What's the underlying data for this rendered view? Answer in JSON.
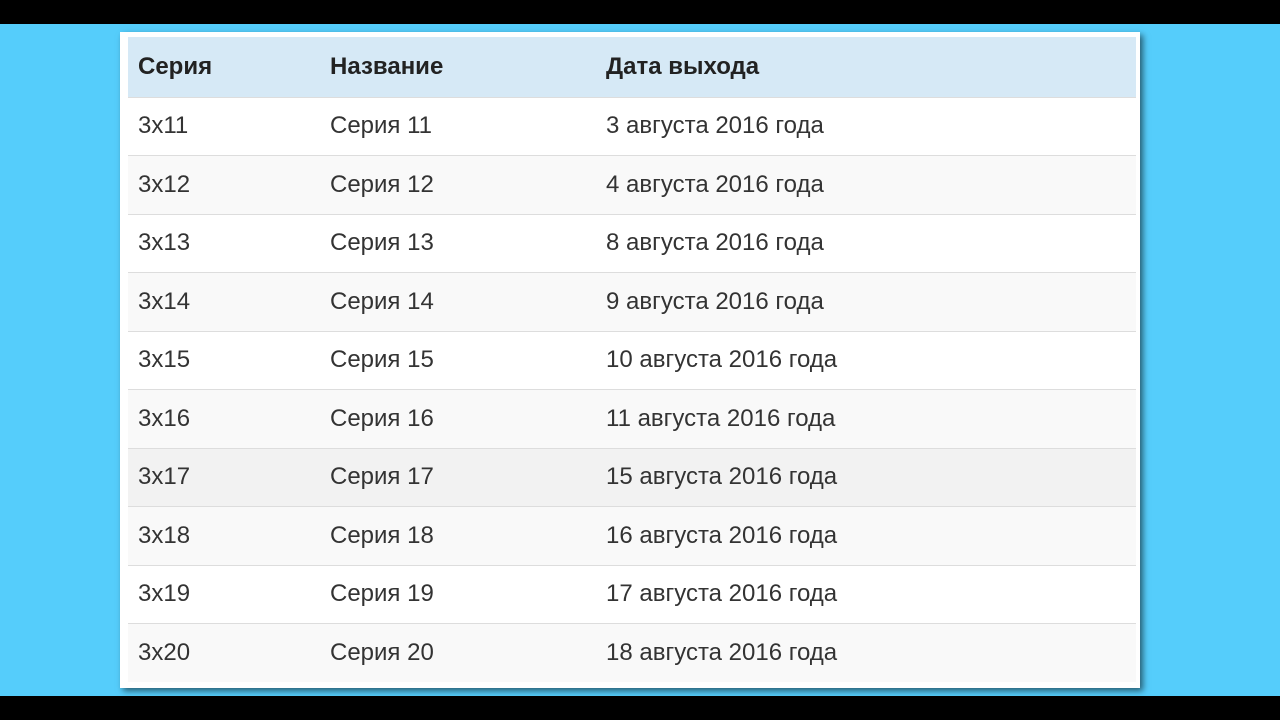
{
  "table": {
    "headers": [
      "Серия",
      "Название",
      "Дата выхода"
    ],
    "rows": [
      [
        "3x11",
        "Серия 11",
        "3 августа 2016 года"
      ],
      [
        "3x12",
        "Серия 12",
        "4 августа 2016 года"
      ],
      [
        "3x13",
        "Серия 13",
        "8 августа 2016 года"
      ],
      [
        "3x14",
        "Серия 14",
        "9 августа 2016 года"
      ],
      [
        "3x15",
        "Серия 15",
        "10 августа 2016 года"
      ],
      [
        "3x16",
        "Серия 16",
        "11 августа 2016 года"
      ],
      [
        "3x17",
        "Серия 17",
        "15 августа 2016 года"
      ],
      [
        "3x18",
        "Серия 18",
        "16 августа 2016 года"
      ],
      [
        "3x19",
        "Серия 19",
        "17 августа 2016 года"
      ],
      [
        "3x20",
        "Серия 20",
        "18 августа 2016 года"
      ]
    ]
  },
  "colors": {
    "background": "#55cdfb",
    "header": "#d6e9f6",
    "stripe": "#f9f9f9"
  }
}
